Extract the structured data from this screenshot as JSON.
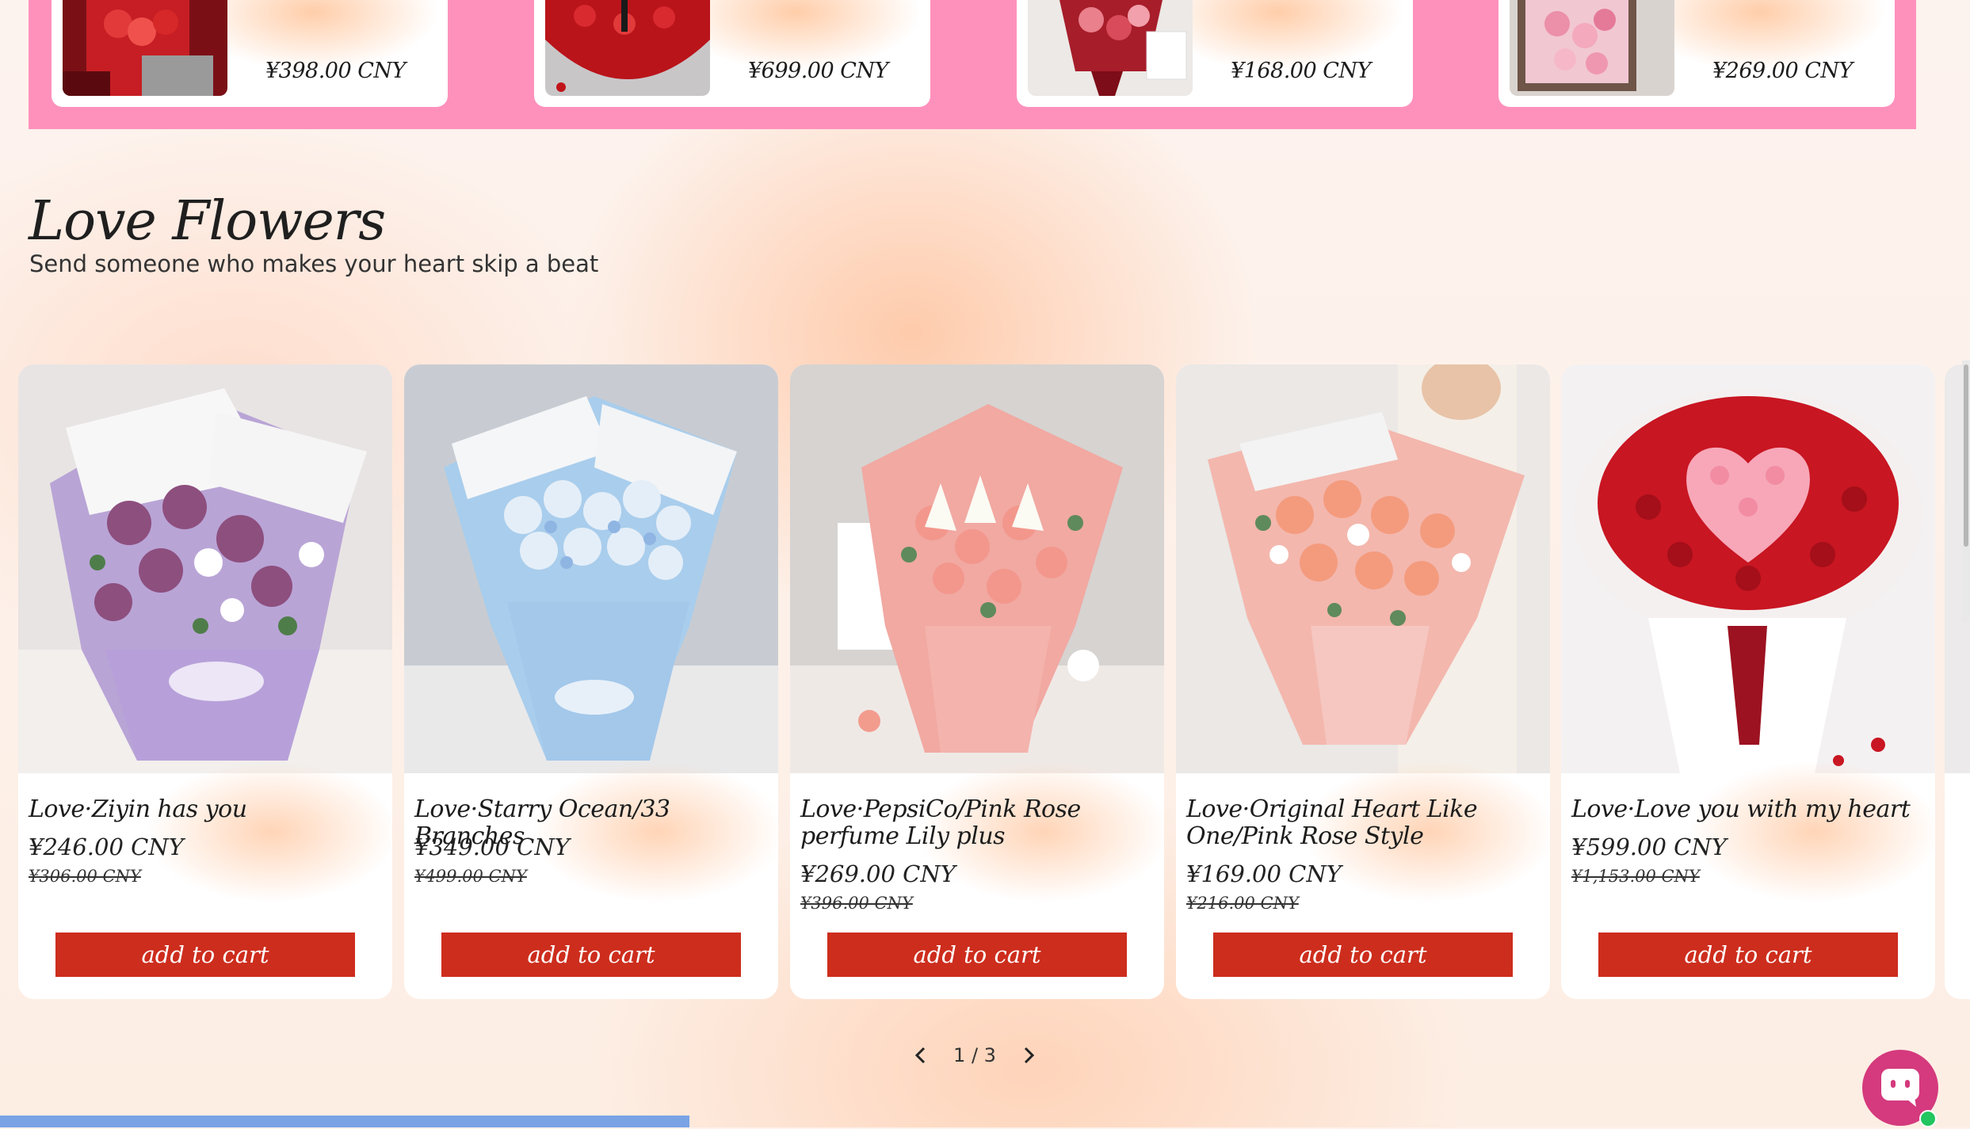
{
  "colors": {
    "band": "#fe91bc",
    "button": "#cd2d1d",
    "chat": "#d43a7d",
    "online": "#22c55e"
  },
  "top_products": [
    {
      "price": "¥398.00 CNY"
    },
    {
      "price": "¥699.00 CNY"
    },
    {
      "price": "¥168.00 CNY"
    },
    {
      "price": "¥269.00 CNY"
    }
  ],
  "section": {
    "title": "Love Flowers",
    "subtitle": "Send someone who makes your heart skip a beat"
  },
  "products": [
    {
      "name": "Love·Ziyin has you",
      "price": "¥246.00 CNY",
      "compare_price": "¥306.00 CNY",
      "button": "add to cart"
    },
    {
      "name": "Love·Starry Ocean/33 Branches",
      "price": "¥349.00 CNY",
      "compare_price": "¥499.00 CNY",
      "button": "add to cart"
    },
    {
      "name": "Love·PepsiCo/Pink Rose perfume Lily plus",
      "price": "¥269.00 CNY",
      "compare_price": "¥396.00 CNY",
      "button": "add to cart"
    },
    {
      "name": "Love·Original Heart Like One/Pink Rose Style",
      "price": "¥169.00 CNY",
      "compare_price": "¥216.00 CNY",
      "button": "add to cart"
    },
    {
      "name": "Love·Love you with my heart",
      "price": "¥599.00 CNY",
      "compare_price": "¥1,153.00 CNY",
      "button": "add to cart"
    }
  ],
  "pager": {
    "text": "1 / 3",
    "prev_icon": "chevron-left-icon",
    "next_icon": "chevron-right-icon"
  },
  "chat": {
    "icon": "chat-bubble-icon"
  }
}
